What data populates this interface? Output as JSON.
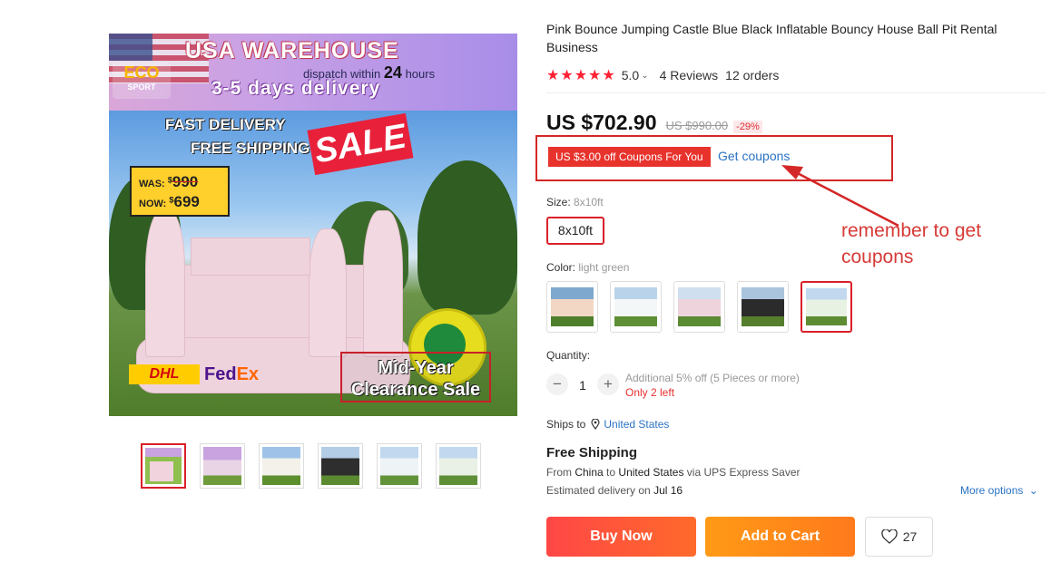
{
  "product": {
    "title": "Pink Bounce Jumping Castle Blue Black Inflatable Bouncy House Ball Pit Rental Business",
    "rating": "5.0",
    "rating_caret": "⌄",
    "reviews": "4 Reviews",
    "orders": "12 orders",
    "star_count": 5,
    "star_color": "#ff2233"
  },
  "main_image": {
    "banner_warehouse": "USA WAREHOUSE",
    "banner_dispatch_prefix": "dispatch within",
    "banner_dispatch_hours": "24",
    "banner_dispatch_suffix": "hours",
    "banner_delivery": "3-5 days delivery",
    "logo_text": "ECO",
    "logo_sub": "SPORT",
    "fast_delivery": "FAST DELIVERY",
    "free_shipping": "FREE SHIPPING",
    "sale_tag": "SALE",
    "was_label": "WAS:",
    "was_currency": "$",
    "was_value": "990",
    "now_label": "NOW:",
    "now_currency": "$",
    "now_value": "699",
    "clearance_line1": "Mid-Year",
    "clearance_line2": "Clearance Sale",
    "dhl": "DHL",
    "fedex_a": "Fed",
    "fedex_b": "Ex"
  },
  "thumbnails": [
    {
      "name": "thumb-1",
      "selected": true
    },
    {
      "name": "thumb-2",
      "selected": false
    },
    {
      "name": "thumb-3",
      "selected": false
    },
    {
      "name": "thumb-4",
      "selected": false
    },
    {
      "name": "thumb-5",
      "selected": false
    },
    {
      "name": "thumb-6",
      "selected": false
    }
  ],
  "price": {
    "current": "US $702.90",
    "original": "US $990.00",
    "discount": "-29%"
  },
  "coupon": {
    "chip": "US $3.00 off Coupons For You",
    "link": "Get coupons",
    "annotation": "remember to get coupons",
    "annotation_color": "#d63a36"
  },
  "size": {
    "label": "Size:",
    "value": "8x10ft",
    "option": "8x10ft"
  },
  "color": {
    "label": "Color:",
    "value": "light green",
    "swatches": [
      "swatch-peach",
      "swatch-white",
      "swatch-pink",
      "swatch-black",
      "swatch-light-green"
    ],
    "selected_index": 4
  },
  "quantity": {
    "label": "Quantity:",
    "minus": "−",
    "plus": "+",
    "value": "1",
    "additional": "Additional 5% off (5 Pieces or more)",
    "stock": "Only 2 left"
  },
  "shipping": {
    "ships_to_label": "Ships to",
    "location_icon": "location-pin-icon",
    "country": "United States",
    "heading": "Free Shipping",
    "from_prefix": "From",
    "from_country": "China",
    "to_prefix": "to",
    "to_country": "United States",
    "via": "via UPS Express Saver",
    "est_prefix": "Estimated delivery on",
    "est_date": "Jul 16",
    "more_options": "More options",
    "more_caret": "⌄"
  },
  "actions": {
    "buy_now": "Buy Now",
    "add_to_cart": "Add to Cart",
    "wishlist_count": "27",
    "buy_color": "#ff4747",
    "cart_color": "#ff9a16"
  }
}
